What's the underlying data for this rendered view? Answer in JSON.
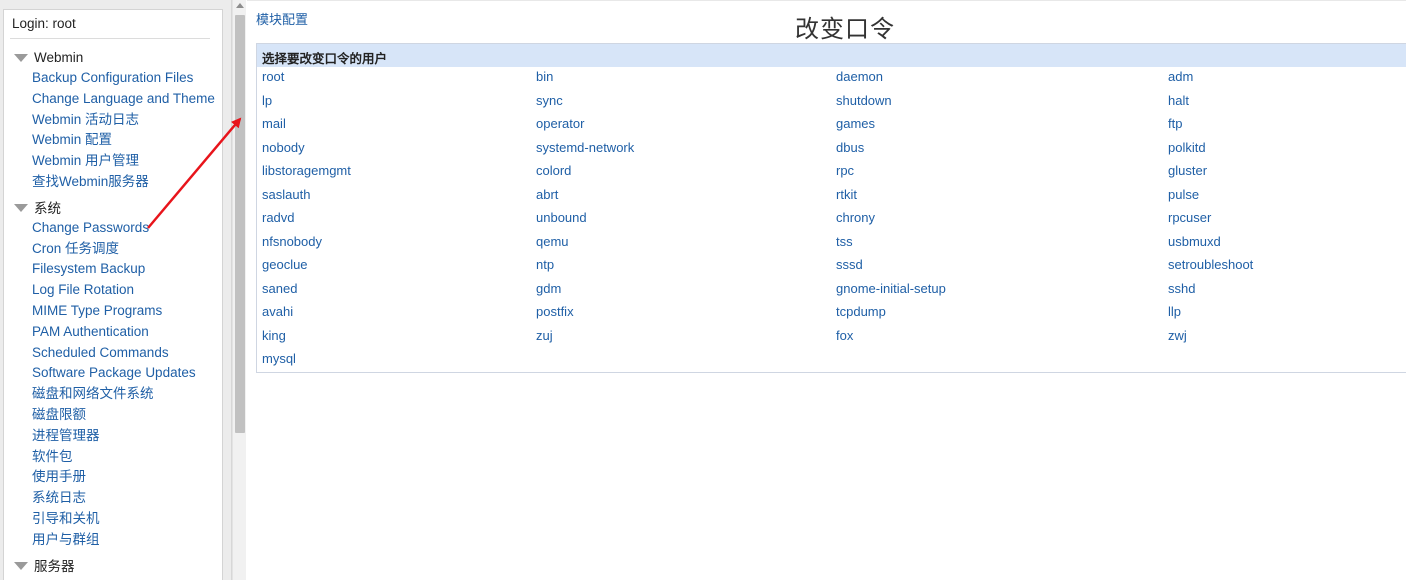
{
  "sidebar": {
    "login": "Login: root",
    "sections": [
      {
        "title": "Webmin",
        "items": [
          "Backup Configuration Files",
          "Change Language and Theme",
          "Webmin 活动日志",
          "Webmin 配置",
          "Webmin 用户管理",
          "查找Webmin服务器"
        ]
      },
      {
        "title": "系统",
        "items": [
          "Change Passwords",
          "Cron 任务调度",
          "Filesystem Backup",
          "Log File Rotation",
          "MIME Type Programs",
          "PAM Authentication",
          "Scheduled Commands",
          "Software Package Updates",
          "磁盘和网络文件系统",
          "磁盘限额",
          "进程管理器",
          "软件包",
          "使用手册",
          "系统日志",
          "引导和关机",
          "用户与群组"
        ]
      },
      {
        "title": "服务器",
        "items": []
      }
    ]
  },
  "main": {
    "module_config": "模块配置",
    "title": "改变口令",
    "box_title": "选择要改变口令的用户",
    "user_rows": [
      [
        "root",
        "bin",
        "daemon",
        "adm"
      ],
      [
        "lp",
        "sync",
        "shutdown",
        "halt"
      ],
      [
        "mail",
        "operator",
        "games",
        "ftp"
      ],
      [
        "nobody",
        "systemd-network",
        "dbus",
        "polkitd"
      ],
      [
        "libstoragemgmt",
        "colord",
        "rpc",
        "gluster"
      ],
      [
        "saslauth",
        "abrt",
        "rtkit",
        "pulse"
      ],
      [
        "radvd",
        "unbound",
        "chrony",
        "rpcuser"
      ],
      [
        "nfsnobody",
        "qemu",
        "tss",
        "usbmuxd"
      ],
      [
        "geoclue",
        "ntp",
        "sssd",
        "setroubleshoot"
      ],
      [
        "saned",
        "gdm",
        "gnome-initial-setup",
        "sshd"
      ],
      [
        "avahi",
        "postfix",
        "tcpdump",
        "llp"
      ],
      [
        "king",
        "zuj",
        "fox",
        "zwj"
      ],
      [
        "mysql"
      ]
    ]
  },
  "colors": {
    "link": "#1f5fa6",
    "header_bg": "#d7e5f8",
    "annotation_arrow": "#e8141b"
  }
}
